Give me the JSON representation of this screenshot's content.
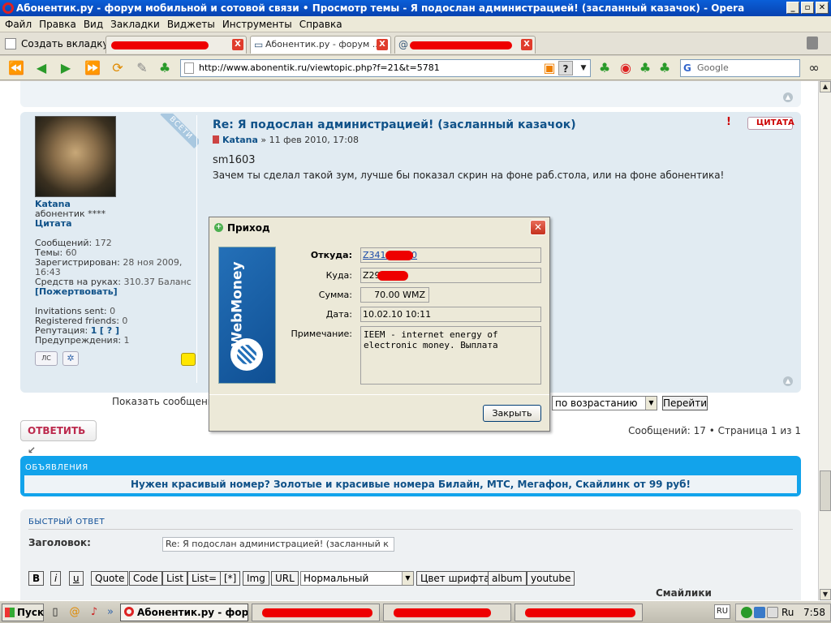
{
  "window": {
    "title": "Абонентик.ру - форум мобильной и сотовой связи • Просмотр темы - Я подослан администрацией! (засланный казачок) - Opera",
    "buttons": [
      "_",
      "▫",
      "✕"
    ]
  },
  "menu": [
    "Файл",
    "Правка",
    "Вид",
    "Закладки",
    "Виджеты",
    "Инструменты",
    "Справка"
  ],
  "tabs": {
    "new_tab_label": "Создать вкладку",
    "items": [
      {
        "label": "",
        "redacted": true
      },
      {
        "label": "Абонентик.ру - форум ...",
        "active": true
      },
      {
        "label": "",
        "redacted": true
      }
    ],
    "close_glyph": "X"
  },
  "nav": {
    "url": "http://www.abonentik.ru/viewtopic.php?f=21&t=5781",
    "search_engine": "Google",
    "help_glyph": "?"
  },
  "post": {
    "ribbon": "ВСЕТИ",
    "title": "Re: Я подослан администрацией! (засланный казачок)",
    "author": "Katana",
    "date": "» 11 фев 2010, 17:08",
    "quote_label": "ЦИТАТА",
    "body_name": "sm1603",
    "body_text": "Зачем ты сделал такой зум, лучше бы показал скрин на фоне раб.стола, или на фоне абонентика!",
    "user": {
      "name": "Katana",
      "rank": "абонентик ****",
      "quote_link": "Цитата",
      "messages_label": "Сообщений:",
      "messages": "172",
      "topics_label": "Темы:",
      "topics": "60",
      "registered_label": "Зарегистрирован:",
      "registered": "28 ноя 2009, 16:43",
      "funds_label": "Средств на руках:",
      "funds": "310.37 Баланс",
      "donate": "[Пожертвовать]",
      "invitations_label": "Invitations sent:",
      "invitations": "0",
      "friends_label": "Registered friends:",
      "friends": "0",
      "rep_label": "Репутация:",
      "rep": "1",
      "rep_q": "[ ? ]",
      "warn_label": "Предупреждения:",
      "warn": "1",
      "pm_label": "ЛС"
    }
  },
  "sort": {
    "label": "Показать сообщени",
    "order": "по возрастанию",
    "go": "Перейти"
  },
  "reply_label": "ОТВЕТИТЬ",
  "pagination": "Сообщений: 17 • Страница 1 из 1",
  "announce": {
    "header": "ОБЪЯВЛЕНИЯ",
    "message": "Нужен красивый номер? Золотые и красивые номера Билайн, МТС, Мегафон, Скайлинк от 99 руб!"
  },
  "quick_reply": {
    "header": "БЫСТРЫЙ ОТВЕТ",
    "subject_label": "Заголовок:",
    "subject_value": "Re: Я подослан администрацией! (засланный к",
    "format_buttons": [
      "B",
      "i",
      "u",
      "Quote",
      "Code",
      "List",
      "List=",
      "[*]",
      "Img",
      "URL"
    ],
    "size_select": "Нормальный",
    "extra_buttons": [
      "Цвет шрифта",
      "album",
      "youtube"
    ],
    "smiles": "Смайлики"
  },
  "dialog": {
    "title": "Приход",
    "logo_text": "WebMoney",
    "from_label": "Откуда:",
    "from_value": "Z341          99910",
    "to_label": "Куда:",
    "to_value": "Z29          0770",
    "sum_label": "Сумма:",
    "sum_value": "70.00 WMZ",
    "date_label": "Дата:",
    "date_value": "10.02.10 10:11",
    "note_label": "Примечание:",
    "note_value": "IEEM - internet energy of electronic money. Выплата",
    "close_button": "Закрыть",
    "close_glyph": "✕"
  },
  "taskbar": {
    "start": "Пуск",
    "tasks": [
      {
        "label": "Абонентик.ру - фору...",
        "active": true
      },
      {
        "label": "",
        "redacted": true
      },
      {
        "label": "",
        "redacted": true
      },
      {
        "label": "",
        "redacted": true
      }
    ],
    "lang": "RU",
    "tray_lang": "Ru",
    "clock": "7:58"
  }
}
